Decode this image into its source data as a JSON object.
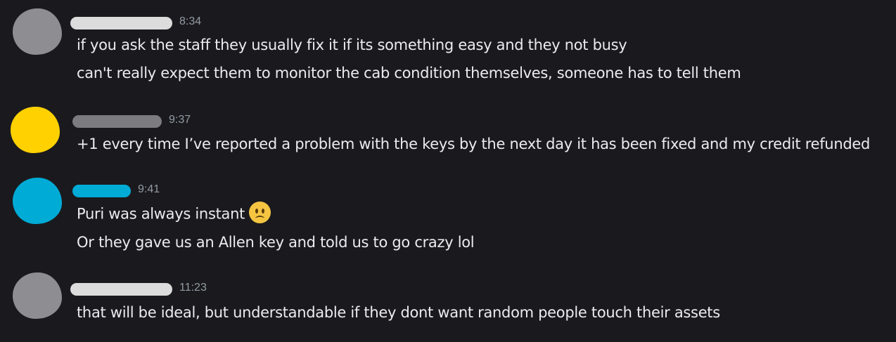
{
  "messages": [
    {
      "avatar_color": "#8e8e92",
      "name_color": "#dcdcdc",
      "time": "8:34",
      "lines": [
        "if you ask the staff they usually fix it if its something easy and they not busy",
        "can't really expect them to monitor the cab condition themselves, someone has to tell them"
      ]
    },
    {
      "avatar_color": "#ffd100",
      "name_color": "#7b7b80",
      "time": "9:37",
      "lines": [
        "+1 every time I’ve reported a problem with the keys by the next day it has been fixed and my credit refunded"
      ]
    },
    {
      "avatar_color": "#00abd6",
      "name_color": "#00abd6",
      "time": "9:41",
      "lines": [
        "Puri was always instant",
        "Or they gave us an Allen key and told us to go crazy lol"
      ],
      "emoji": "slightly-frowning-face-emoji"
    },
    {
      "avatar_color": "#8e8e92",
      "name_color": "#dcdcdc",
      "time": "11:23",
      "lines": [
        "that will be ideal, but understandable if they dont want random people touch their assets"
      ]
    }
  ]
}
